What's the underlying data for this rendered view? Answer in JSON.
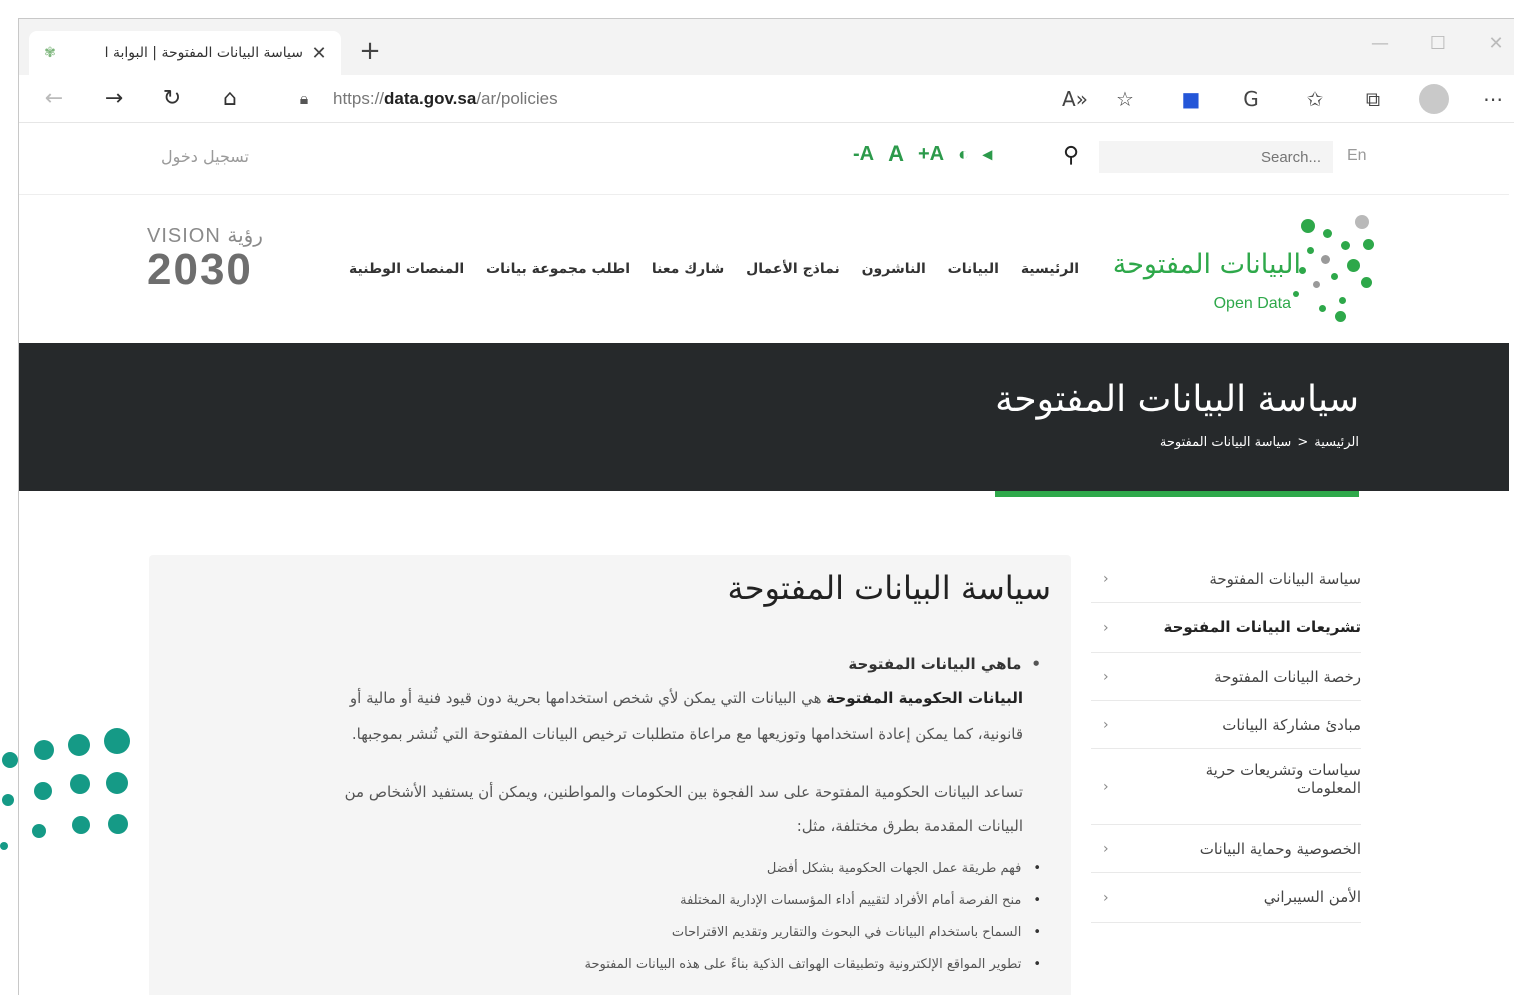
{
  "browser": {
    "tab_title": "سياسة البيانات المفتوحة | البوابة ا",
    "tab_close": "✕",
    "new_tab": "+",
    "url_scheme": "https://",
    "url_host": "data.gov.sa",
    "url_path": "/ar/policies",
    "win_min": "—",
    "win_max": "☐",
    "win_close": "✕"
  },
  "utility": {
    "login": "تسجيل دخول",
    "font_decrease": "-A",
    "font_normal": "A",
    "font_increase": "+A",
    "search_placeholder": "Search...",
    "lang": "En"
  },
  "header": {
    "vision_top": "VISION رؤية",
    "vision_num": "2030",
    "brand_ar": "البيانات المفتوحة",
    "brand_en": "Open Data",
    "nav": [
      "الرئيسية",
      "البيانات",
      "الناشرون",
      "نماذج الأعمال",
      "شارك معنا",
      "اطلب مجموعة بيانات",
      "المنصات الوطنية"
    ]
  },
  "banner": {
    "title": "سياسة البيانات المفتوحة",
    "breadcrumb_home": "الرئيسية",
    "breadcrumb_sep": "<",
    "breadcrumb_current": "سياسة البيانات المفتوحة"
  },
  "content": {
    "heading": "سياسة البيانات المفتوحة",
    "question": "ماهي البيانات المفتوحة",
    "p1_bold": "البيانات الحكومية المفتوحة",
    "p1_rest": " هي البيانات التي يمكن لأي شخص استخدامها بحرية دون قيود فنية أو مالية أو",
    "p1_line2": "قانونية، كما يمكن إعادة استخدامها وتوزيعها مع مراعاة متطلبات ترخيص البيانات المفتوحة التي تُنشر بموجبها.",
    "p2_line1": "تساعد البيانات الحكومية المفتوحة على سد الفجوة بين الحكومات والمواطنين، ويمكن أن يستفيد الأشخاص من",
    "p2_line2": "البيانات المقدمة بطرق مختلفة، مثل:",
    "bullets": [
      "فهم طريقة عمل الجهات الحكومية بشكل أفضل",
      "منح الفرصة أمام الأفراد لتقييم أداء المؤسسات الإدارية المختلفة",
      "السماح باستخدام البيانات في البحوث والتقارير وتقديم الاقتراحات",
      "تطوير المواقع الإلكترونية وتطبيقات الهواتف الذكية بناءً على هذه البيانات المفتوحة"
    ]
  },
  "sidebar": {
    "items": [
      {
        "label": "سياسة البيانات المفتوحة"
      },
      {
        "label": "تشريعات البيانات المفتوحة"
      },
      {
        "label": "رخصة البيانات المفتوحة"
      },
      {
        "label": "مبادئ مشاركة البيانات"
      },
      {
        "label": "سياسات وتشريعات حرية",
        "label2": "المعلومات"
      },
      {
        "label": "الخصوصية وحماية البيانات"
      },
      {
        "label": "الأمن السيبراني"
      }
    ]
  },
  "colors": {
    "brand_green": "#2ea84a",
    "banner_dark": "#26292b",
    "deco_teal": "#159a86"
  }
}
